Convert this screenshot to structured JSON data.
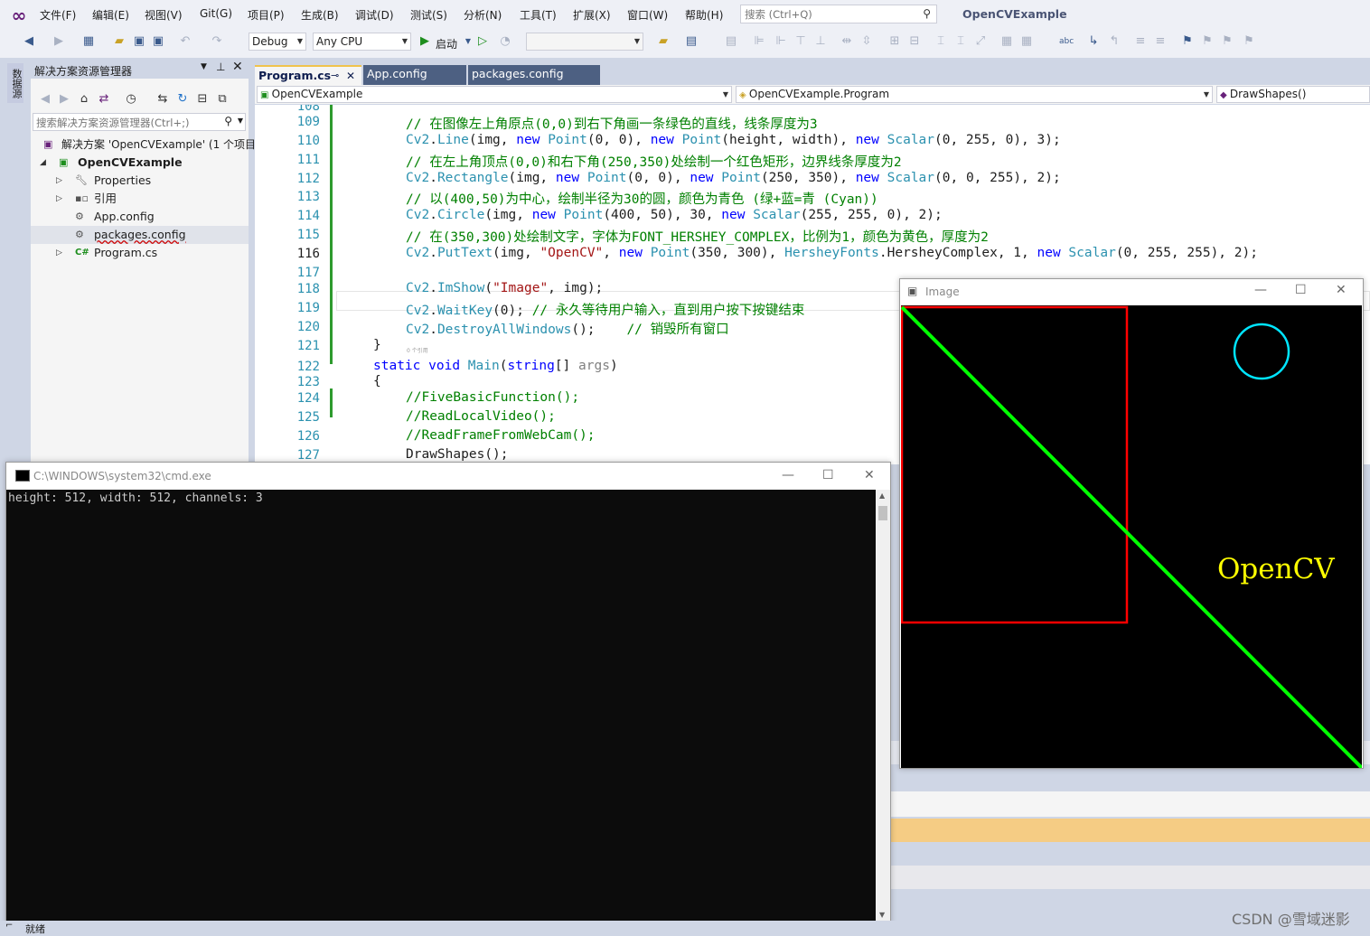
{
  "app": {
    "title": "OpenCVExample",
    "menu": [
      "文件(F)",
      "编辑(E)",
      "视图(V)",
      "Git(G)",
      "项目(P)",
      "生成(B)",
      "调试(D)",
      "测试(S)",
      "分析(N)",
      "工具(T)",
      "扩展(X)",
      "窗口(W)",
      "帮助(H)"
    ],
    "search_placeholder": "搜索 (Ctrl+Q)"
  },
  "toolbar": {
    "config": "Debug",
    "platform": "Any CPU",
    "start_label": "启动"
  },
  "left_strip": {
    "server_tab": "数据源"
  },
  "solution_explorer": {
    "title": "解决方案资源管理器",
    "search_placeholder": "搜索解决方案资源管理器(Ctrl+;)",
    "items": [
      {
        "label": "解决方案 'OpenCVExample' (1 个项目"
      },
      {
        "label": "OpenCVExample"
      },
      {
        "label": "Properties"
      },
      {
        "label": "引用"
      },
      {
        "label": "App.config"
      },
      {
        "label": "packages.config"
      },
      {
        "label": "Program.cs"
      }
    ]
  },
  "editor": {
    "tabs": [
      {
        "label": "Program.cs"
      },
      {
        "label": "App.config"
      },
      {
        "label": "packages.config"
      }
    ],
    "nav": {
      "project": "OpenCVExample",
      "class": "OpenCVExample.Program",
      "member": "DrawShapes()"
    },
    "line_numbers": [
      "108",
      "109",
      "110",
      "111",
      "112",
      "113",
      "114",
      "115",
      "116",
      "117",
      "118",
      "119",
      "120",
      "121",
      "122",
      "123",
      "124",
      "125",
      "126",
      "127"
    ],
    "code": {
      "l109": "// 在图像左上角原点(0,0)到右下角画一条绿色的直线，线条厚度为3",
      "l110": [
        {
          "c": "ty",
          "t": "Cv2"
        },
        {
          "c": "",
          "t": "."
        },
        {
          "c": "ty",
          "t": "Line"
        },
        {
          "c": "",
          "t": "(img, "
        },
        {
          "c": "kw",
          "t": "new"
        },
        {
          "c": "",
          "t": " "
        },
        {
          "c": "ty",
          "t": "Point"
        },
        {
          "c": "",
          "t": "(0, 0), "
        },
        {
          "c": "kw",
          "t": "new"
        },
        {
          "c": "",
          "t": " "
        },
        {
          "c": "ty",
          "t": "Point"
        },
        {
          "c": "",
          "t": "(height, width), "
        },
        {
          "c": "kw",
          "t": "new"
        },
        {
          "c": "",
          "t": " "
        },
        {
          "c": "ty",
          "t": "Scalar"
        },
        {
          "c": "",
          "t": "(0, 255, 0), 3);"
        }
      ],
      "l111": "// 在左上角顶点(0,0)和右下角(250,350)处绘制一个红色矩形，边界线条厚度为2",
      "l112": [
        {
          "c": "ty",
          "t": "Cv2"
        },
        {
          "c": "",
          "t": "."
        },
        {
          "c": "ty",
          "t": "Rectangle"
        },
        {
          "c": "",
          "t": "(img, "
        },
        {
          "c": "kw",
          "t": "new"
        },
        {
          "c": "",
          "t": " "
        },
        {
          "c": "ty",
          "t": "Point"
        },
        {
          "c": "",
          "t": "(0, 0), "
        },
        {
          "c": "kw",
          "t": "new"
        },
        {
          "c": "",
          "t": " "
        },
        {
          "c": "ty",
          "t": "Point"
        },
        {
          "c": "",
          "t": "(250, 350), "
        },
        {
          "c": "kw",
          "t": "new"
        },
        {
          "c": "",
          "t": " "
        },
        {
          "c": "ty",
          "t": "Scalar"
        },
        {
          "c": "",
          "t": "(0, 0, 255), 2);"
        }
      ],
      "l113": "// 以(400,50)为中心，绘制半径为30的圆，颜色为青色 (绿+蓝=青 (Cyan))",
      "l114": [
        {
          "c": "ty",
          "t": "Cv2"
        },
        {
          "c": "",
          "t": "."
        },
        {
          "c": "ty",
          "t": "Circle"
        },
        {
          "c": "",
          "t": "(img, "
        },
        {
          "c": "kw",
          "t": "new"
        },
        {
          "c": "",
          "t": " "
        },
        {
          "c": "ty",
          "t": "Point"
        },
        {
          "c": "",
          "t": "(400, 50), 30, "
        },
        {
          "c": "kw",
          "t": "new"
        },
        {
          "c": "",
          "t": " "
        },
        {
          "c": "ty",
          "t": "Scalar"
        },
        {
          "c": "",
          "t": "(255, 255, 0), 2);"
        }
      ],
      "l115": "// 在(350,300)处绘制文字，字体为FONT_HERSHEY_COMPLEX，比例为1，颜色为黄色，厚度为2",
      "l116": [
        {
          "c": "ty",
          "t": "Cv2"
        },
        {
          "c": "",
          "t": "."
        },
        {
          "c": "ty",
          "t": "PutText"
        },
        {
          "c": "",
          "t": "(img, "
        },
        {
          "c": "st",
          "t": "\"OpenCV\""
        },
        {
          "c": "",
          "t": ", "
        },
        {
          "c": "kw",
          "t": "new"
        },
        {
          "c": "",
          "t": " "
        },
        {
          "c": "ty",
          "t": "Point"
        },
        {
          "c": "",
          "t": "(350, 300), "
        },
        {
          "c": "ty",
          "t": "HersheyFonts"
        },
        {
          "c": "",
          "t": ".HersheyComplex, 1, "
        },
        {
          "c": "kw",
          "t": "new"
        },
        {
          "c": "",
          "t": " "
        },
        {
          "c": "ty",
          "t": "Scalar"
        },
        {
          "c": "",
          "t": "(0, 255, 255), 2);"
        }
      ],
      "l118": [
        {
          "c": "ty",
          "t": "Cv2"
        },
        {
          "c": "",
          "t": "."
        },
        {
          "c": "ty",
          "t": "ImShow"
        },
        {
          "c": "",
          "t": "("
        },
        {
          "c": "st",
          "t": "\"Image\""
        },
        {
          "c": "",
          "t": ", img);"
        }
      ],
      "l119": [
        {
          "c": "ty",
          "t": "Cv2"
        },
        {
          "c": "",
          "t": "."
        },
        {
          "c": "ty",
          "t": "WaitKey"
        },
        {
          "c": "",
          "t": "(0); "
        },
        {
          "c": "cm",
          "t": "// 永久等待用户输入，直到用户按下按键结束"
        }
      ],
      "l120": [
        {
          "c": "ty",
          "t": "Cv2"
        },
        {
          "c": "",
          "t": "."
        },
        {
          "c": "ty",
          "t": "DestroyAllWindows"
        },
        {
          "c": "",
          "t": "();    "
        },
        {
          "c": "cm",
          "t": "// 销毁所有窗口"
        }
      ],
      "l121": "}",
      "l122": [
        {
          "c": "kw",
          "t": "static"
        },
        {
          "c": "",
          "t": " "
        },
        {
          "c": "kw",
          "t": "void"
        },
        {
          "c": "",
          "t": " "
        },
        {
          "c": "ty",
          "t": "Main"
        },
        {
          "c": "",
          "t": "("
        },
        {
          "c": "kw",
          "t": "string"
        },
        {
          "c": "",
          "t": "[] "
        },
        {
          "c": "gy",
          "t": "args"
        },
        {
          "c": "",
          "t": ")"
        }
      ],
      "l123": "{",
      "l124": "//FiveBasicFunction();",
      "l125": "//ReadLocalVideo();",
      "l126": "//ReadFrameFromWebCam();",
      "l127": "DrawShapes();"
    }
  },
  "image_window": {
    "title": "Image",
    "text": "OpenCV",
    "colors": {
      "line": "#00ff00",
      "rect": "#ff0000",
      "circle": "#00e5ff",
      "text": "#ffff00"
    }
  },
  "cmd_window": {
    "title": "C:\\WINDOWS\\system32\\cmd.exe",
    "output": "height: 512, width: 512, channels: 3"
  },
  "status": {
    "text": "就绪"
  },
  "watermark": "CSDN @雪域迷影"
}
